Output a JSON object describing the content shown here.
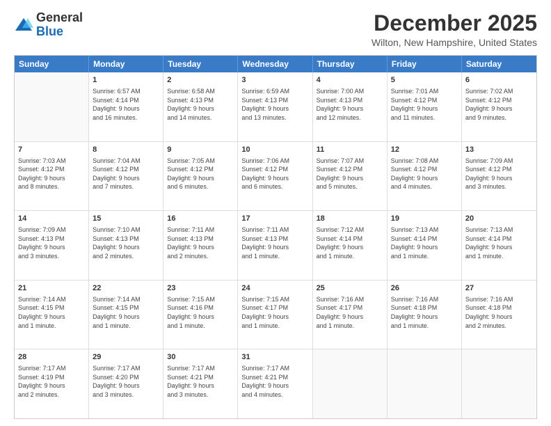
{
  "header": {
    "logo_general": "General",
    "logo_blue": "Blue",
    "month_title": "December 2025",
    "location": "Wilton, New Hampshire, United States"
  },
  "days_of_week": [
    "Sunday",
    "Monday",
    "Tuesday",
    "Wednesday",
    "Thursday",
    "Friday",
    "Saturday"
  ],
  "weeks": [
    [
      {
        "day": "",
        "info": ""
      },
      {
        "day": "1",
        "info": "Sunrise: 6:57 AM\nSunset: 4:14 PM\nDaylight: 9 hours\nand 16 minutes."
      },
      {
        "day": "2",
        "info": "Sunrise: 6:58 AM\nSunset: 4:13 PM\nDaylight: 9 hours\nand 14 minutes."
      },
      {
        "day": "3",
        "info": "Sunrise: 6:59 AM\nSunset: 4:13 PM\nDaylight: 9 hours\nand 13 minutes."
      },
      {
        "day": "4",
        "info": "Sunrise: 7:00 AM\nSunset: 4:13 PM\nDaylight: 9 hours\nand 12 minutes."
      },
      {
        "day": "5",
        "info": "Sunrise: 7:01 AM\nSunset: 4:12 PM\nDaylight: 9 hours\nand 11 minutes."
      },
      {
        "day": "6",
        "info": "Sunrise: 7:02 AM\nSunset: 4:12 PM\nDaylight: 9 hours\nand 9 minutes."
      }
    ],
    [
      {
        "day": "7",
        "info": "Sunrise: 7:03 AM\nSunset: 4:12 PM\nDaylight: 9 hours\nand 8 minutes."
      },
      {
        "day": "8",
        "info": "Sunrise: 7:04 AM\nSunset: 4:12 PM\nDaylight: 9 hours\nand 7 minutes."
      },
      {
        "day": "9",
        "info": "Sunrise: 7:05 AM\nSunset: 4:12 PM\nDaylight: 9 hours\nand 6 minutes."
      },
      {
        "day": "10",
        "info": "Sunrise: 7:06 AM\nSunset: 4:12 PM\nDaylight: 9 hours\nand 6 minutes."
      },
      {
        "day": "11",
        "info": "Sunrise: 7:07 AM\nSunset: 4:12 PM\nDaylight: 9 hours\nand 5 minutes."
      },
      {
        "day": "12",
        "info": "Sunrise: 7:08 AM\nSunset: 4:12 PM\nDaylight: 9 hours\nand 4 minutes."
      },
      {
        "day": "13",
        "info": "Sunrise: 7:09 AM\nSunset: 4:12 PM\nDaylight: 9 hours\nand 3 minutes."
      }
    ],
    [
      {
        "day": "14",
        "info": "Sunrise: 7:09 AM\nSunset: 4:13 PM\nDaylight: 9 hours\nand 3 minutes."
      },
      {
        "day": "15",
        "info": "Sunrise: 7:10 AM\nSunset: 4:13 PM\nDaylight: 9 hours\nand 2 minutes."
      },
      {
        "day": "16",
        "info": "Sunrise: 7:11 AM\nSunset: 4:13 PM\nDaylight: 9 hours\nand 2 minutes."
      },
      {
        "day": "17",
        "info": "Sunrise: 7:11 AM\nSunset: 4:13 PM\nDaylight: 9 hours\nand 1 minute."
      },
      {
        "day": "18",
        "info": "Sunrise: 7:12 AM\nSunset: 4:14 PM\nDaylight: 9 hours\nand 1 minute."
      },
      {
        "day": "19",
        "info": "Sunrise: 7:13 AM\nSunset: 4:14 PM\nDaylight: 9 hours\nand 1 minute."
      },
      {
        "day": "20",
        "info": "Sunrise: 7:13 AM\nSunset: 4:14 PM\nDaylight: 9 hours\nand 1 minute."
      }
    ],
    [
      {
        "day": "21",
        "info": "Sunrise: 7:14 AM\nSunset: 4:15 PM\nDaylight: 9 hours\nand 1 minute."
      },
      {
        "day": "22",
        "info": "Sunrise: 7:14 AM\nSunset: 4:15 PM\nDaylight: 9 hours\nand 1 minute."
      },
      {
        "day": "23",
        "info": "Sunrise: 7:15 AM\nSunset: 4:16 PM\nDaylight: 9 hours\nand 1 minute."
      },
      {
        "day": "24",
        "info": "Sunrise: 7:15 AM\nSunset: 4:17 PM\nDaylight: 9 hours\nand 1 minute."
      },
      {
        "day": "25",
        "info": "Sunrise: 7:16 AM\nSunset: 4:17 PM\nDaylight: 9 hours\nand 1 minute."
      },
      {
        "day": "26",
        "info": "Sunrise: 7:16 AM\nSunset: 4:18 PM\nDaylight: 9 hours\nand 1 minute."
      },
      {
        "day": "27",
        "info": "Sunrise: 7:16 AM\nSunset: 4:18 PM\nDaylight: 9 hours\nand 2 minutes."
      }
    ],
    [
      {
        "day": "28",
        "info": "Sunrise: 7:17 AM\nSunset: 4:19 PM\nDaylight: 9 hours\nand 2 minutes."
      },
      {
        "day": "29",
        "info": "Sunrise: 7:17 AM\nSunset: 4:20 PM\nDaylight: 9 hours\nand 3 minutes."
      },
      {
        "day": "30",
        "info": "Sunrise: 7:17 AM\nSunset: 4:21 PM\nDaylight: 9 hours\nand 3 minutes."
      },
      {
        "day": "31",
        "info": "Sunrise: 7:17 AM\nSunset: 4:21 PM\nDaylight: 9 hours\nand 4 minutes."
      },
      {
        "day": "",
        "info": ""
      },
      {
        "day": "",
        "info": ""
      },
      {
        "day": "",
        "info": ""
      }
    ]
  ]
}
